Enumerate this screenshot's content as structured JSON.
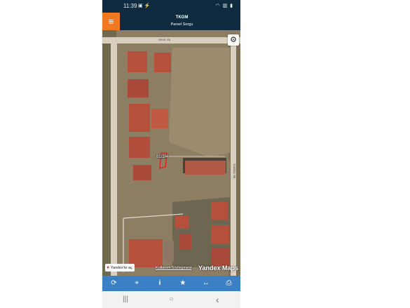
{
  "status_bar": {
    "time": "11:39",
    "left_icons": "▣ ⚡",
    "right_icons": "◠ ▥ ▮"
  },
  "header": {
    "title": "TKGM",
    "subtitle": "Parsel Sorgu",
    "menu_icon": "menu-icon"
  },
  "map": {
    "parcel_label": "81/1/4",
    "street_labels": [
      "Hisar Sk.",
      "Gürbüz Sk."
    ],
    "yandex_open": "Yandex'te aç",
    "terms": "Kullanım Sözleşmesi",
    "logo": "Yandex Maps",
    "colors": {
      "parcel_outline": "#e02020",
      "road": "#d9cfbe",
      "roof": "#b5503c"
    }
  },
  "toolbar": {
    "buttons": [
      {
        "name": "refresh-icon",
        "glyph": "⟳"
      },
      {
        "name": "locate-icon",
        "glyph": "⌖"
      },
      {
        "name": "info-icon",
        "glyph": "i"
      },
      {
        "name": "star-icon",
        "glyph": "★"
      },
      {
        "name": "measure-icon",
        "glyph": "↔"
      },
      {
        "name": "print-icon",
        "glyph": "⎙"
      }
    ],
    "color": "#3b7fc4"
  },
  "nav_bar": {
    "recents": "|||",
    "home": "○",
    "back": "‹"
  },
  "accent": "#f07a22"
}
